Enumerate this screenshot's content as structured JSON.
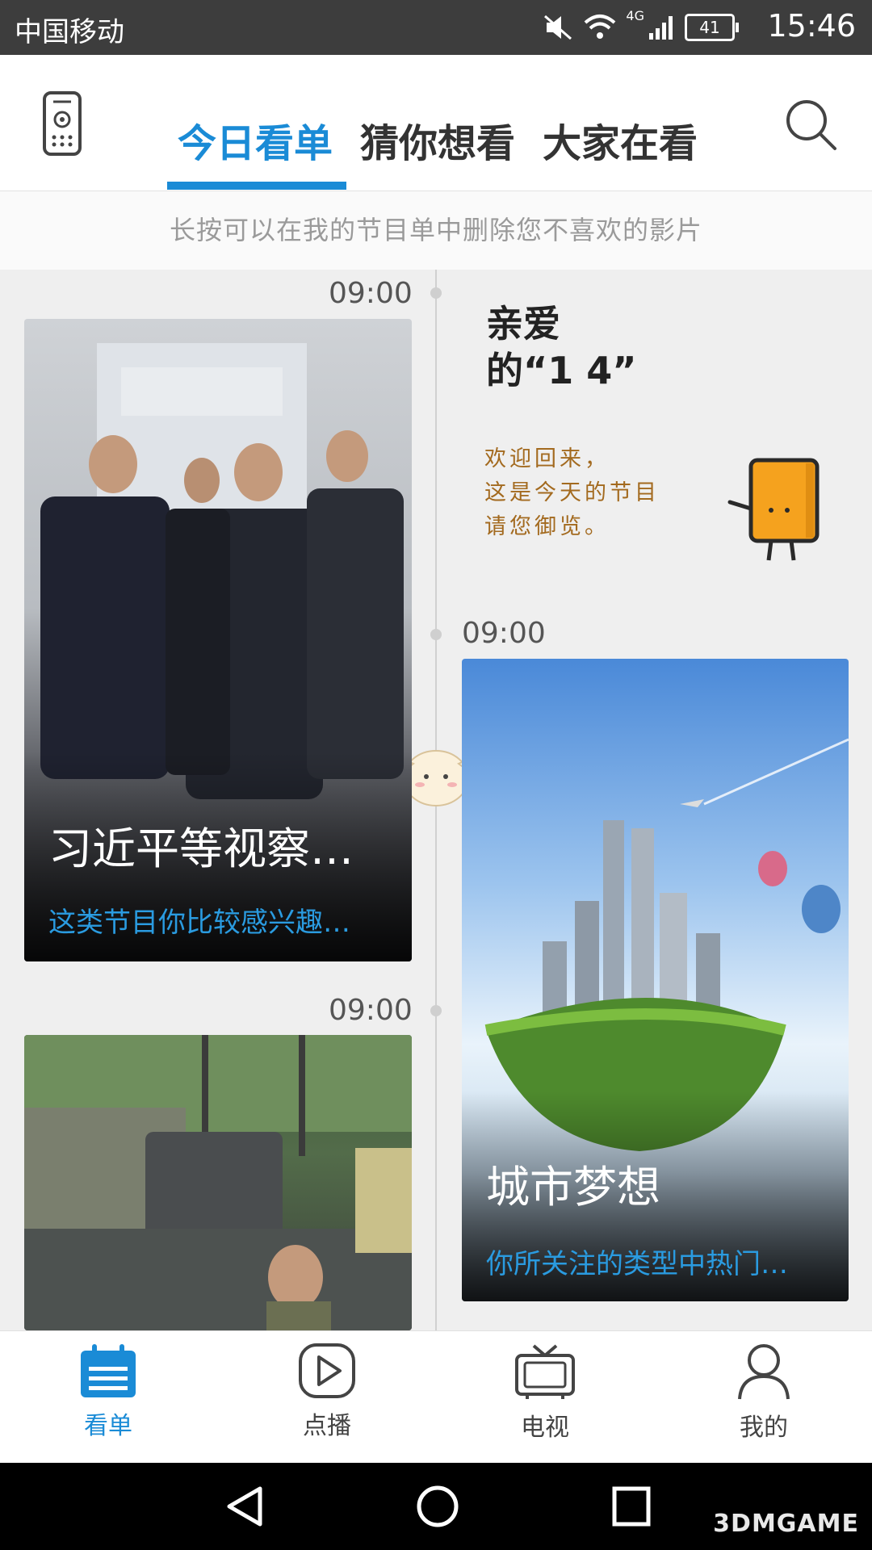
{
  "status_bar": {
    "carrier": "中国移动",
    "network": "4G",
    "battery": "41",
    "time": "15:46"
  },
  "header": {
    "tabs": [
      {
        "label": "今日看单",
        "active": true
      },
      {
        "label": "猜你想看",
        "active": false
      },
      {
        "label": "大家在看",
        "active": false
      }
    ],
    "accent_color": "#1a8bd6",
    "left_icon": "remote-control-icon",
    "right_icon": "search-icon"
  },
  "hint": "长按可以在我的节目单中删除您不喜欢的影片",
  "welcome": {
    "title_line1": "亲爱",
    "title_line2": "的“1          4”",
    "message_lines": [
      "欢迎回来，",
      "这是今天的节目",
      "请您御览。"
    ]
  },
  "timeline": {
    "times": [
      "09:00",
      "09:00",
      "09:00"
    ]
  },
  "cards": [
    {
      "title": "习近平等视察…",
      "subtitle": "这类节目你比较感兴趣…",
      "time": "09:00"
    },
    {
      "title": "城市梦想",
      "subtitle": "你所关注的类型中热门…",
      "time": "09:00"
    },
    {
      "title": "",
      "subtitle": "",
      "time": "09:00"
    }
  ],
  "bottom_nav": [
    {
      "label": "看单",
      "icon": "calendar-icon",
      "active": true
    },
    {
      "label": "点播",
      "icon": "play-icon",
      "active": false
    },
    {
      "label": "电视",
      "icon": "tv-icon",
      "active": false
    },
    {
      "label": "我的",
      "icon": "user-icon",
      "active": false
    }
  ],
  "watermark": "3DMGAME"
}
